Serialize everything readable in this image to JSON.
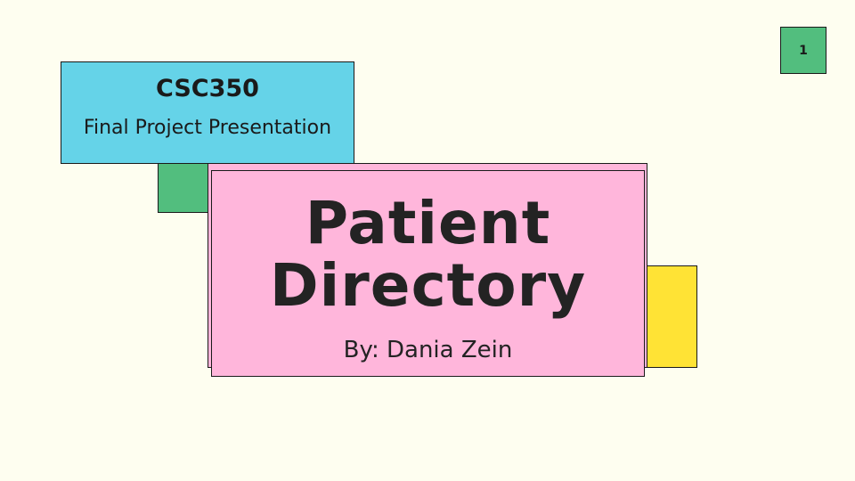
{
  "colors": {
    "background": "#FEFEF0",
    "course_box": "#65D3E8",
    "title_box": "#FFB6DB",
    "accent_green": "#52BE7E",
    "accent_yellow": "#FFE335"
  },
  "course": {
    "code": "CSC350",
    "subtitle": "Final Project Presentation"
  },
  "title": {
    "line1": "Patient",
    "line2": "Directory",
    "byline": "By: Dania Zein"
  },
  "page": {
    "number": "1"
  }
}
